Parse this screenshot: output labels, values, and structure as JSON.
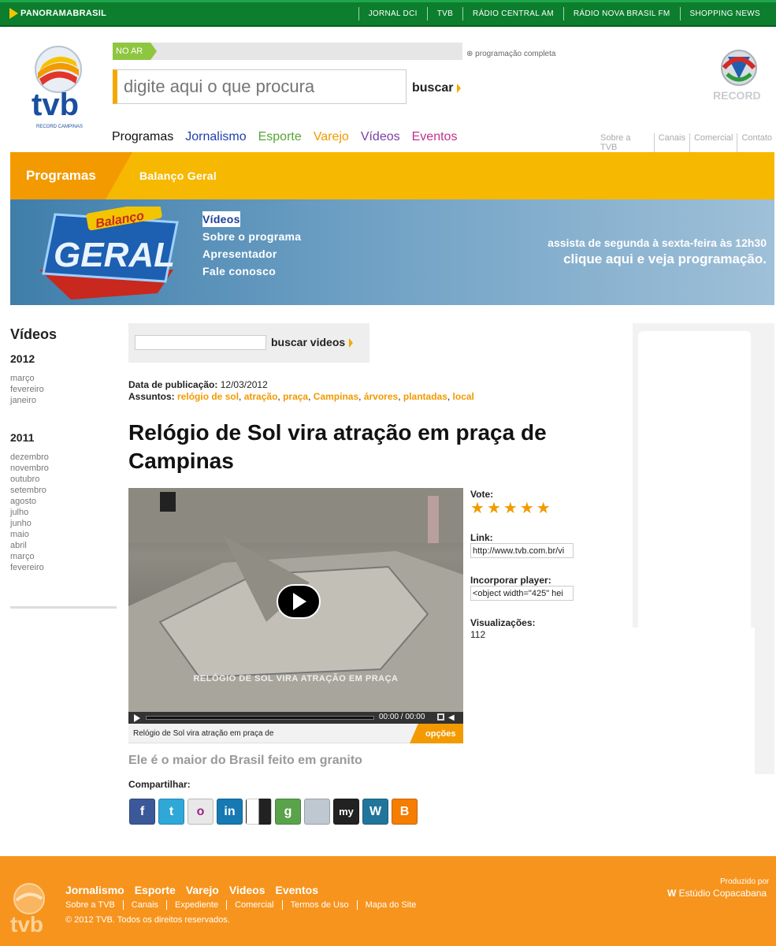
{
  "topbar": {
    "brand": "PANORAMABRASIL",
    "links": [
      "JORNAL DCI",
      "TVB",
      "RÁDIO CENTRAL AM",
      "RÁDIO NOVA BRASIL FM",
      "SHOPPING NEWS"
    ]
  },
  "logo": {
    "text": "tvb",
    "subtext": "RECORD CAMPINAS",
    "partner": "RECORD"
  },
  "onair": {
    "label": "NO AR",
    "full_schedule": "programação completa"
  },
  "search": {
    "placeholder": "digite aqui o que procura",
    "button": "buscar"
  },
  "mainnav": [
    {
      "label": "Programas",
      "color": "#111111"
    },
    {
      "label": "Jornalismo",
      "color": "#1f3fae"
    },
    {
      "label": "Esporte",
      "color": "#55a634"
    },
    {
      "label": "Varejo",
      "color": "#f29a00"
    },
    {
      "label": "Vídeos",
      "color": "#7b3fa6"
    },
    {
      "label": "Eventos",
      "color": "#c2308c"
    }
  ],
  "sitelinks": [
    "Sobre a TVB",
    "Canais",
    "Comercial",
    "Contato"
  ],
  "section": {
    "tab": "Programas",
    "program": "Balanço Geral"
  },
  "banner": {
    "logo_top": "Balanço",
    "logo_bottom": "GERAL",
    "menu": [
      "Vídeos",
      "Sobre o programa",
      "Apresentador",
      "Fale conosco"
    ],
    "schedule": "assista de segunda à sexta-feira às 12h30",
    "cta": "clique aqui e veja programação."
  },
  "sidebar": {
    "title": "Vídeos",
    "years": [
      {
        "year": "2012",
        "months": [
          "março",
          "fevereiro",
          "janeiro"
        ]
      },
      {
        "year": "2011",
        "months": [
          "dezembro",
          "novembro",
          "outubro",
          "setembro",
          "agosto",
          "julho",
          "junho",
          "maio",
          "abril",
          "março",
          "fevereiro"
        ]
      }
    ]
  },
  "video_search": {
    "button": "buscar videos"
  },
  "article": {
    "pub_label": "Data de publicação:",
    "pub_date": "12/03/2012",
    "topics_label": "Assuntos:",
    "topics": [
      "relógio de sol",
      "atração",
      "praça",
      "Campinas",
      "árvores",
      "plantadas",
      "local"
    ],
    "headline": "Relógio de Sol vira atração em praça de Campinas",
    "subtitle": "Ele é o maior do Brasil feito em granito"
  },
  "player": {
    "caption": "RELÓGIO DE SOL VIRA ATRAÇÃO EM PRAÇA",
    "current_time": "00:00",
    "total_time": "00:00",
    "title": "Relógio de Sol vira atração em praça de",
    "options": "opções"
  },
  "details": {
    "vote_label": "Vote:",
    "stars": 5,
    "link_label": "Link:",
    "link_value": "http://www.tvb.com.br/vi",
    "embed_label": "Incorporar player:",
    "embed_value": "<object width=\"425\" hei",
    "views_label": "Visualizações:",
    "views_value": "112"
  },
  "share": {
    "label": "Compartilhar:",
    "services": [
      {
        "name": "facebook-icon",
        "glyph": "f",
        "color": "#3b5998"
      },
      {
        "name": "twitter-icon",
        "glyph": "t",
        "color": "#2fa8d8"
      },
      {
        "name": "orkut-icon",
        "glyph": "o",
        "color": "#e8e8e8"
      },
      {
        "name": "linkedin-icon",
        "glyph": "in",
        "color": "#1679b3"
      },
      {
        "name": "delicious-icon",
        "glyph": "",
        "color": "#ffffff"
      },
      {
        "name": "google-bookmarks-icon",
        "glyph": "g",
        "color": "#5aa34b"
      },
      {
        "name": "digg-icon",
        "glyph": "",
        "color": "#bfc8d0"
      },
      {
        "name": "myspace-icon",
        "glyph": "my",
        "color": "#222222"
      },
      {
        "name": "wordpress-icon",
        "glyph": "W",
        "color": "#21759b"
      },
      {
        "name": "blogger-icon",
        "glyph": "B",
        "color": "#f57d00"
      }
    ]
  },
  "footer": {
    "nav": [
      "Jornalismo",
      "Esporte",
      "Varejo",
      "Videos",
      "Eventos"
    ],
    "links": [
      "Sobre a TVB",
      "Canais",
      "Expediente",
      "Comercial",
      "Termos de Uso",
      "Mapa do Site"
    ],
    "copyright": "© 2012 TVB. Todos os direitos reservados.",
    "produced_by": "Produzido por",
    "producer": "Estúdio Copacabana",
    "logo_text": "tvb"
  },
  "colors": {
    "accent_orange": "#f29a00",
    "topbar_green": "#0c7e2d",
    "footer_orange": "#f7941d"
  }
}
